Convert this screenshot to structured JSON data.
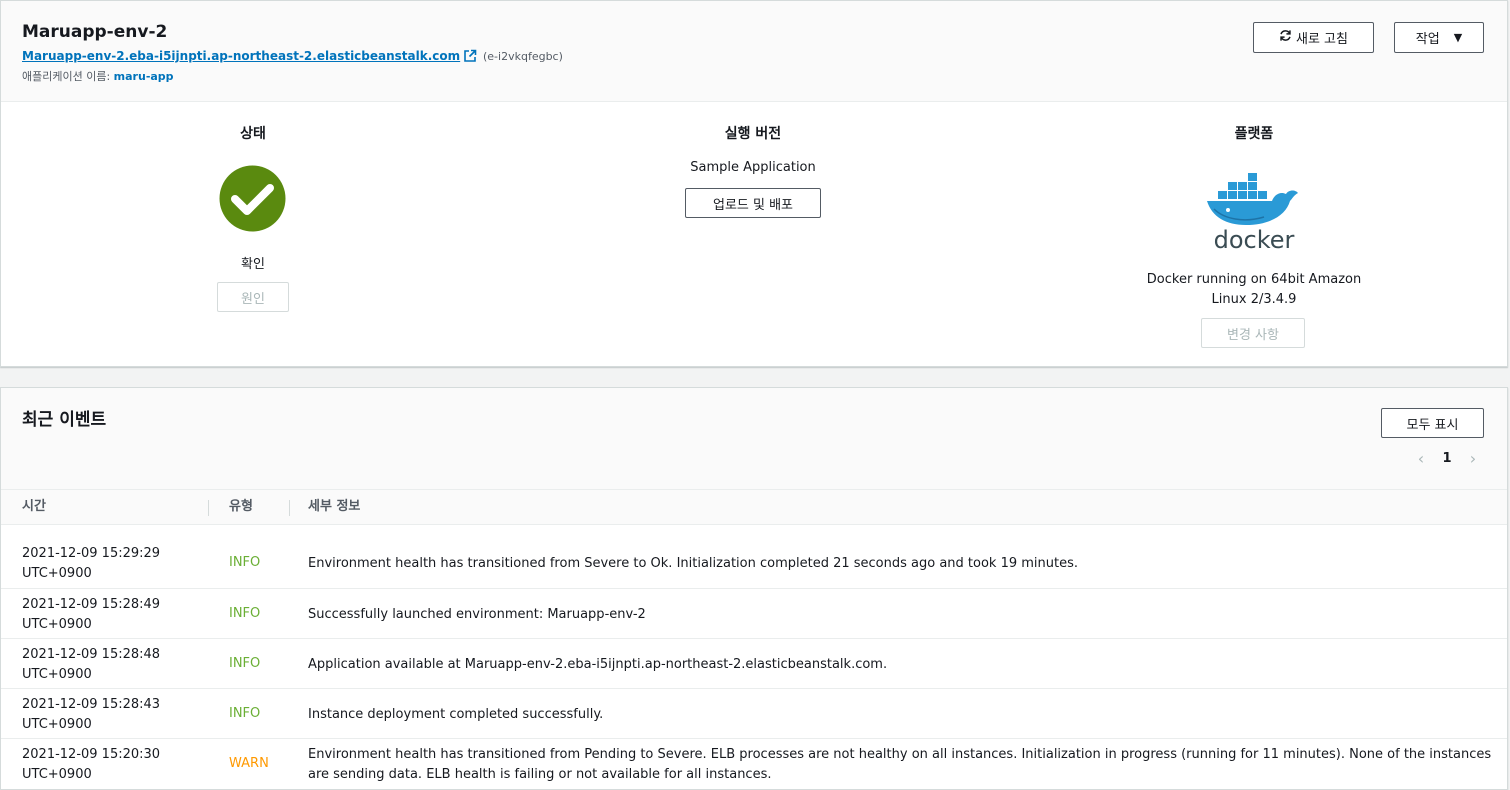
{
  "environment": {
    "name": "Maruapp-env-2",
    "url": "Maruapp-env-2.eba-i5ijnpti.ap-northeast-2.elasticbeanstalk.com",
    "env_id": "(e-i2vkqfegbc)",
    "app_label": "애플리케이션 이름:",
    "app_name": "maru-app",
    "refresh_label": "새로 고침",
    "actions_label": "작업",
    "accent_color": "#0073bb"
  },
  "status": {
    "title": "상태",
    "value": "확인",
    "cause_label": "원인",
    "icon": "check-circle-icon",
    "color": "#5a8a0f"
  },
  "version": {
    "title": "실행 버전",
    "label": "Sample Application",
    "upload_label": "업로드 및 배포"
  },
  "platform": {
    "title": "플랫폼",
    "logo": "docker-logo",
    "logo_text": "docker",
    "description": "Docker running on 64bit Amazon Linux 2/3.4.9",
    "changes_label": "변경 사항"
  },
  "events": {
    "title": "최근 이벤트",
    "show_all_label": "모두 표시",
    "page": "1",
    "columns": [
      "시간",
      "유형",
      "세부 정보"
    ],
    "rows": [
      {
        "date": "2021-12-09 15:29:29",
        "tz": "UTC+0900",
        "type": "INFO",
        "detail": "Environment health has transitioned from Severe to Ok. Initialization completed 21 seconds ago and took 19 minutes."
      },
      {
        "date": "2021-12-09 15:28:49",
        "tz": "UTC+0900",
        "type": "INFO",
        "detail": "Successfully launched environment: Maruapp-env-2"
      },
      {
        "date": "2021-12-09 15:28:48",
        "tz": "UTC+0900",
        "type": "INFO",
        "detail": "Application available at Maruapp-env-2.eba-i5ijnpti.ap-northeast-2.elasticbeanstalk.com."
      },
      {
        "date": "2021-12-09 15:28:43",
        "tz": "UTC+0900",
        "type": "INFO",
        "detail": "Instance deployment completed successfully."
      },
      {
        "date": "2021-12-09 15:20:30",
        "tz": "UTC+0900",
        "type": "WARN",
        "detail": "Environment health has transitioned from Pending to Severe. ELB processes are not healthy on all instances. Initialization in progress (running for 11 minutes). None of the instances are sending data. ELB health is failing or not available for all instances."
      }
    ],
    "info_color": "#6aaf35",
    "warn_color": "#ff9900"
  }
}
